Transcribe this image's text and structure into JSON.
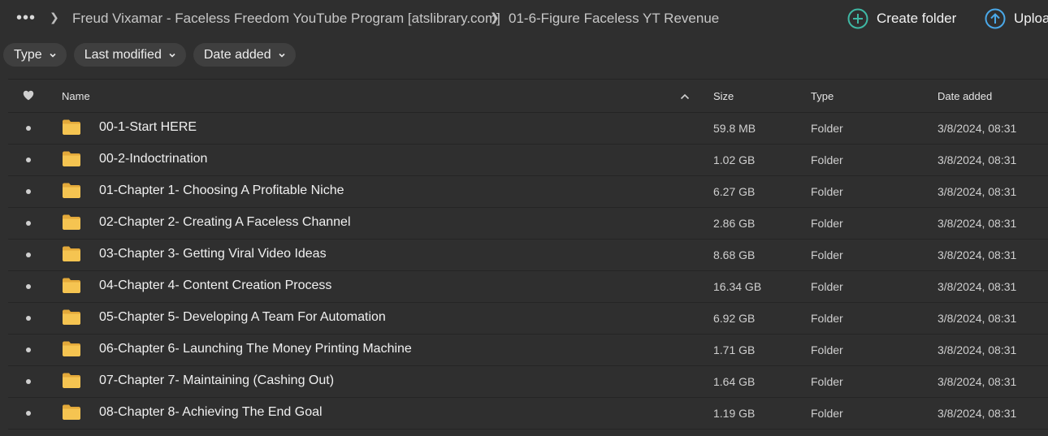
{
  "breadcrumb": {
    "more": "•••",
    "items": [
      "Freud Vixamar - Faceless Freedom YouTube Program [atslibrary.com]",
      "01-6-Figure Faceless YT Revenue"
    ]
  },
  "actions": {
    "create_folder": "Create folder",
    "upload": "Upload"
  },
  "filters": [
    {
      "label": "Type"
    },
    {
      "label": "Last modified"
    },
    {
      "label": "Date added"
    }
  ],
  "columns": {
    "name": "Name",
    "size": "Size",
    "type": "Type",
    "date_added": "Date added"
  },
  "rows": [
    {
      "name": "00-1-Start HERE",
      "size": "59.8 MB",
      "type": "Folder",
      "date": "3/8/2024, 08:31"
    },
    {
      "name": "00-2-Indoctrination",
      "size": "1.02 GB",
      "type": "Folder",
      "date": "3/8/2024, 08:31"
    },
    {
      "name": "01-Chapter 1- Choosing A Profitable Niche",
      "size": "6.27 GB",
      "type": "Folder",
      "date": "3/8/2024, 08:31"
    },
    {
      "name": "02-Chapter 2- Creating A Faceless Channel",
      "size": "2.86 GB",
      "type": "Folder",
      "date": "3/8/2024, 08:31"
    },
    {
      "name": "03-Chapter 3- Getting Viral Video Ideas",
      "size": "8.68 GB",
      "type": "Folder",
      "date": "3/8/2024, 08:31"
    },
    {
      "name": "04-Chapter 4- Content Creation Process",
      "size": "16.34 GB",
      "type": "Folder",
      "date": "3/8/2024, 08:31"
    },
    {
      "name": "05-Chapter 5- Developing A Team For Automation",
      "size": "6.92 GB",
      "type": "Folder",
      "date": "3/8/2024, 08:31"
    },
    {
      "name": "06-Chapter 6- Launching The Money Printing Machine",
      "size": "1.71 GB",
      "type": "Folder",
      "date": "3/8/2024, 08:31"
    },
    {
      "name": "07-Chapter 7- Maintaining (Cashing Out)",
      "size": "1.64 GB",
      "type": "Folder",
      "date": "3/8/2024, 08:31"
    },
    {
      "name": "08-Chapter 8- Achieving The End Goal",
      "size": "1.19 GB",
      "type": "Folder",
      "date": "3/8/2024, 08:31"
    }
  ],
  "colors": {
    "background": "#2f2f2f",
    "accent": "#3fb8a4",
    "upload_accent": "#4aa8e8",
    "folder": "#f5c451"
  }
}
